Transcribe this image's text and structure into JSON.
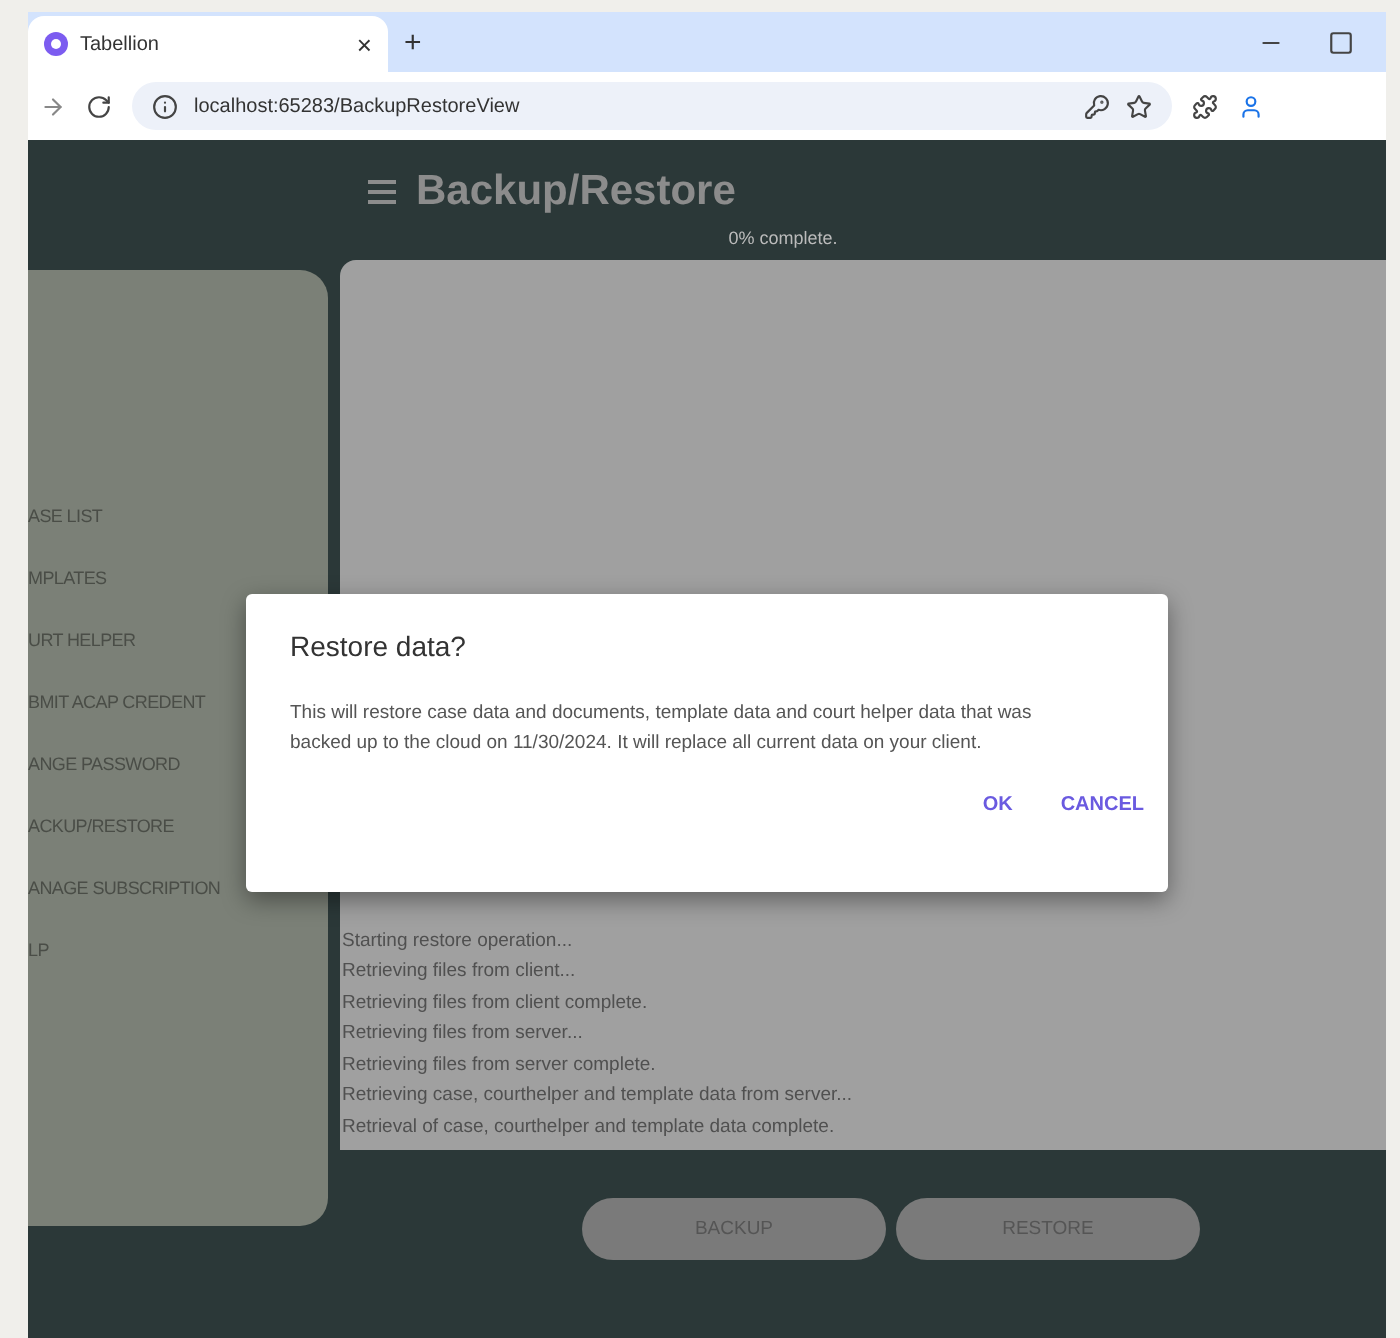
{
  "browser": {
    "tab_title": "Tabellion",
    "close_tab": "×",
    "new_tab": "+",
    "url": "localhost:65283/BackupRestoreView"
  },
  "header": {
    "title": "Backup/Restore"
  },
  "progress": "0% complete.",
  "sidebar": {
    "items": [
      "ASE LIST",
      "MPLATES",
      "URT HELPER",
      "BMIT ACAP CREDENT",
      "ANGE PASSWORD",
      "ACKUP/RESTORE",
      "ANAGE SUBSCRIPTION",
      "LP"
    ]
  },
  "log": [
    "Starting restore operation...",
    "Retrieving files from client...",
    "Retrieving files from client complete.",
    "Retrieving files from server...",
    "Retrieving files from server complete.",
    "Retrieving case, courthelper and template data from server...",
    "Retrieval of case, courthelper and template data complete."
  ],
  "buttons": [
    {
      "label": "BACKUP",
      "disabled": true
    },
    {
      "label": "RESTORE",
      "disabled": true
    }
  ],
  "dialog": {
    "title": "Restore data?",
    "message": "This will restore case data and documents, template data and court helper data that was backed up to the cloud on 11/30/2024. It will replace all current data on your client.",
    "actions": [
      "OK",
      "CANCEL"
    ]
  }
}
